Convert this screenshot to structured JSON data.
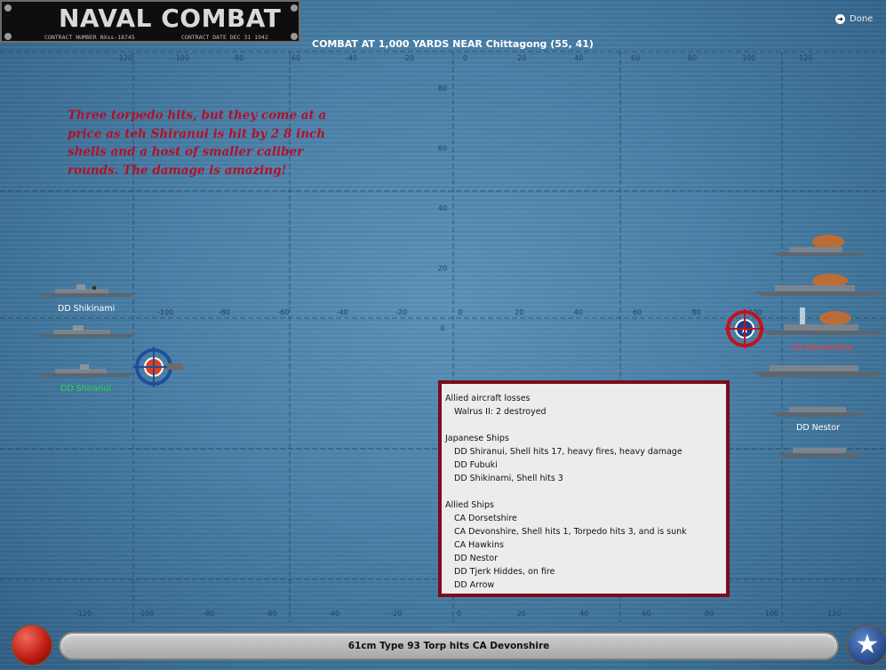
{
  "logo": {
    "title": "NAVAL COMBAT",
    "contract_number": "CONTRACT NUMBER  NXss-18745",
    "contract_date": "CONTRACT DATE  DEC 31 1942"
  },
  "heading": "COMBAT AT 1,000 YARDS NEAR Chittagong (55, 41)",
  "done_label": "Done",
  "note": "Three torpedo hits, but they come at a price as teh Shiranui is hit by 2 8 inch shells and a host of smaller caliber rounds.  The damage is amazing!",
  "axis": {
    "top_x": [
      "-120",
      "-100",
      "-80",
      "-60",
      "-40",
      "-20",
      "0",
      "20",
      "40",
      "60",
      "80",
      "100",
      "120"
    ],
    "mid_x": [
      "-100",
      "-80",
      "-60",
      "-40",
      "-20",
      "0",
      "20",
      "40",
      "60",
      "80",
      "100"
    ],
    "bottom_x": [
      "-120",
      "-100",
      "-80",
      "-60",
      "-40",
      "-20",
      "0",
      "20",
      "40",
      "60",
      "80",
      "100",
      "120"
    ],
    "y": [
      "80",
      "60",
      "40",
      "20",
      "0"
    ]
  },
  "ships": {
    "japanese_label_1": "DD Shikinami",
    "japanese_label_2": "DD Shiranui",
    "allied_label_1": "CA Devonshire",
    "allied_label_2": "DD Nestor"
  },
  "report": {
    "sections": [
      {
        "title": "Allied aircraft losses",
        "rows": [
          "Walrus II: 2 destroyed"
        ]
      },
      {
        "title": "Japanese Ships",
        "rows": [
          "DD Shiranui, Shell hits 17,  heavy fires,  heavy damage",
          "DD Fubuki",
          "DD Shikinami, Shell hits 3"
        ]
      },
      {
        "title": "Allied Ships",
        "rows": [
          "CA Dorsetshire",
          "CA Devonshire, Shell hits 1,  Torpedo hits 3, and is sunk",
          "CA Hawkins",
          "DD Nestor",
          "DD Tjerk Hiddes,  on fire",
          "DD Arrow"
        ]
      }
    ]
  },
  "status_text": "61cm Type 93 Torp hits CA Devonshire",
  "colors": {
    "sea": "#4a80a8",
    "note": "#b2102a",
    "report_border": "#7b0c1c",
    "japanese_label_green": "#2bd94a",
    "allied_label_red": "#ff3b3b"
  }
}
